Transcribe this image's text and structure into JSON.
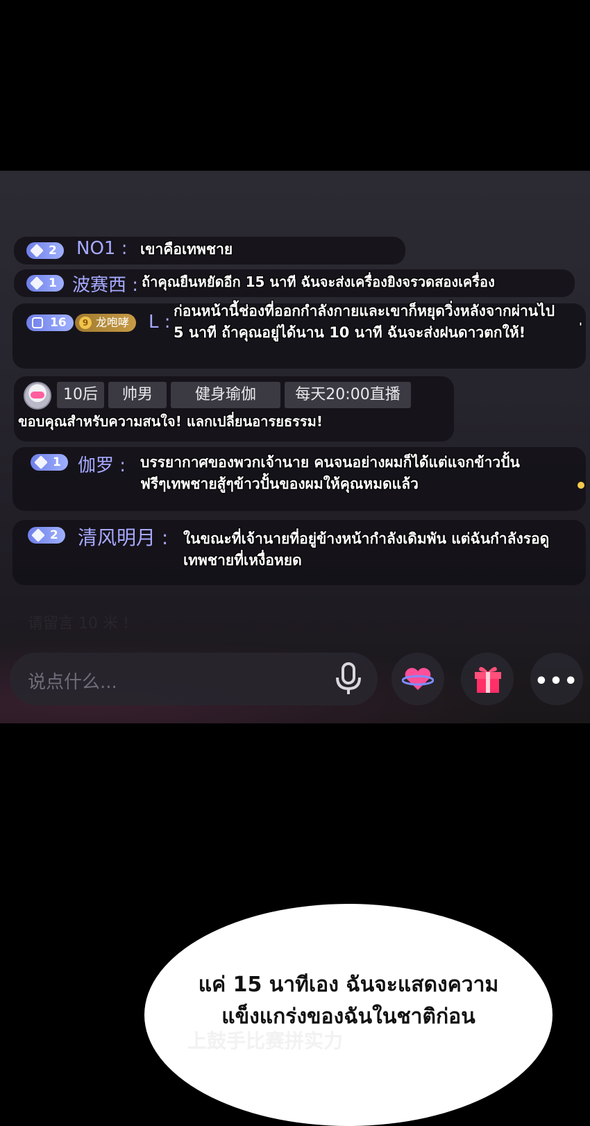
{
  "chat": {
    "messages": [
      {
        "level": "2",
        "user": "NO1 :",
        "text": "เขาคือเทพชาย"
      },
      {
        "level": "1",
        "user": "波赛西 :",
        "text": "ถ้าคุณยืนหยัดอีก 15 นาที ฉันจะส่งเครื่องยิงจรวดสองเครื่อง"
      },
      {
        "level": "16",
        "fan_level": "9",
        "fan_label": "龙咆哮",
        "user": "L :",
        "text": "ก่อนหน้านี้ช่องที่ออกกำลังกายและเขาก็หยุดวิ่งหลังจากผ่านไป 5 นาที ถ้าคุณอยู่ได้นาน 10 นาที ฉันจะส่งฝนดาวตกให้!",
        "trail": "'"
      },
      {
        "tags": [
          "10后",
          "帅男",
          "健身瑜伽",
          "每天20:00直播"
        ],
        "text": "ขอบคุณสำหรับความสนใจ! แลกเปลี่ยนอารยธรรม!"
      },
      {
        "level": "1",
        "user": "伽罗 :",
        "text": "บรรยากาศของพวกเจ้านาย คนจนอย่างผมก็ได้แต่แจกข้าวปั้นฟรีๆเทพชายสู้ๆข้าวปั้นของผมให้คุณหมดแล้ว"
      },
      {
        "level": "2",
        "user": "清风明月 :",
        "text": "ในขณะที่เจ้านายที่อยู่ข้างหน้ากำลังเดิมพัน แต่ฉันกำลังรอดูเทพชายที่เหงื่อหยด"
      }
    ],
    "faded_hint": "请留言 10 米 !"
  },
  "input": {
    "placeholder": "说点什么..."
  },
  "buttons": {
    "more": "•••"
  },
  "icons": {
    "mic": "microphone-icon",
    "heart": "heart-planet-icon",
    "gift": "gift-icon",
    "more": "more-dots-icon"
  },
  "colors": {
    "username": "#a6a9ff",
    "badge": "#8090f0",
    "fan_badge": "#b88e3c",
    "notify": "#f2c94c"
  },
  "caption": {
    "line1": "แค่ 15 นาทีเอง ฉันจะแสดงความ",
    "line2": "แข็งแกร่งของฉันในชาติก่อน",
    "bleed": "上鼓手比赛拼实力"
  }
}
